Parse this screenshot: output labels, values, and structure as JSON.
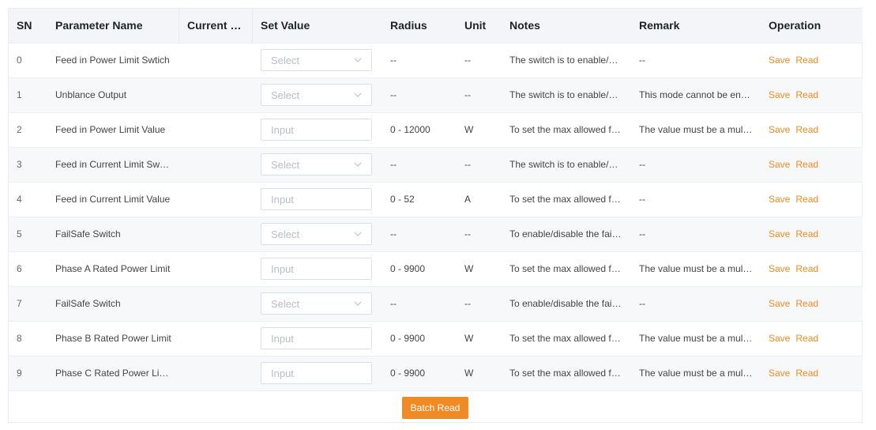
{
  "colors": {
    "accent": "#f08a24",
    "header_bg": "#f3f5f8",
    "stripe_bg": "#f7f8fa"
  },
  "columns": [
    "SN",
    "Parameter Name",
    "Current V...",
    "Set Value",
    "Radius",
    "Unit",
    "Notes",
    "Remark",
    "Operation"
  ],
  "placeholders": {
    "select": "Select",
    "input": "Input"
  },
  "actions": {
    "save": "Save",
    "read": "Read"
  },
  "rows": [
    {
      "sn": "0",
      "name": "Feed in Power Limit Swtich",
      "current": "",
      "control": "select",
      "radius": "--",
      "unit": "--",
      "notes": "The switch is to enable/di...",
      "remark": "--"
    },
    {
      "sn": "1",
      "name": "Unblance Output",
      "current": "",
      "control": "select",
      "radius": "--",
      "unit": "--",
      "notes": "The switch is to enable/di...",
      "remark": "This mode cannot be ena..."
    },
    {
      "sn": "2",
      "name": "Feed in Power Limit Value",
      "current": "",
      "control": "input",
      "radius": "0 - 12000",
      "unit": "W",
      "notes": "To set the max allowed fe...",
      "remark": "The value must be a multi..."
    },
    {
      "sn": "3",
      "name": "Feed in Current Limit Swtich",
      "current": "",
      "control": "select",
      "radius": "--",
      "unit": "--",
      "notes": "The switch is to enable/di...",
      "remark": "--"
    },
    {
      "sn": "4",
      "name": "Feed in Current Limit Value",
      "current": "",
      "control": "input",
      "radius": "0 - 52",
      "unit": "A",
      "notes": "To set the max allowed fe...",
      "remark": "--"
    },
    {
      "sn": "5",
      "name": "FailSafe Switch",
      "current": "",
      "control": "select",
      "radius": "--",
      "unit": "--",
      "notes": "To enable/disable the fails...",
      "remark": "--"
    },
    {
      "sn": "6",
      "name": "Phase A Rated Power Limit",
      "current": "",
      "control": "input",
      "radius": "0 - 9900",
      "unit": "W",
      "notes": "To set the max allowed fe...",
      "remark": "The value must be a multi..."
    },
    {
      "sn": "7",
      "name": "FailSafe Switch",
      "current": "",
      "control": "select",
      "radius": "--",
      "unit": "--",
      "notes": "To enable/disable the fails...",
      "remark": "--"
    },
    {
      "sn": "8",
      "name": "Phase B Rated Power Limit",
      "current": "",
      "control": "input",
      "radius": "0 - 9900",
      "unit": "W",
      "notes": "To set the max allowed fe...",
      "remark": "The value must be a multi..."
    },
    {
      "sn": "9",
      "name": "Phase C Rated Power Limit",
      "current": "",
      "control": "input",
      "radius": "0 - 9900",
      "unit": "W",
      "notes": "To set the max allowed fe...",
      "remark": "The value must be a multi..."
    }
  ],
  "footer": {
    "batch_read_label": "Batch Read"
  }
}
